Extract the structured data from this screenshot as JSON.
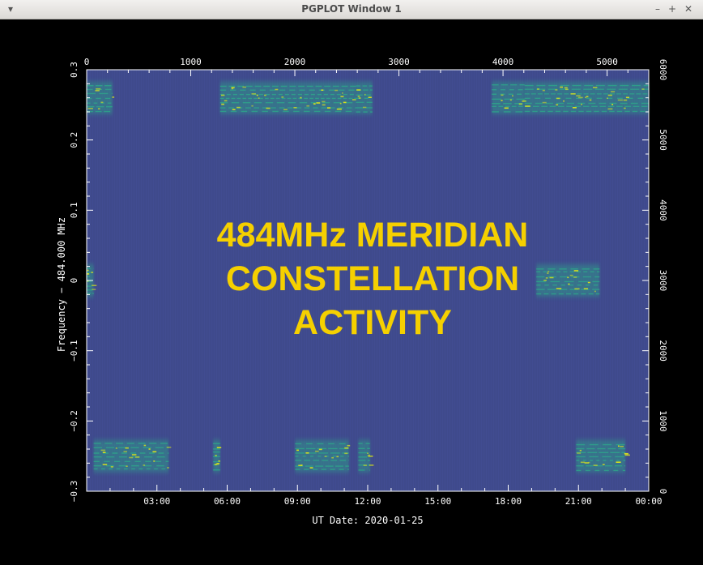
{
  "window": {
    "title": "PGPLOT Window 1",
    "menu_icon": "chevron-down-icon",
    "controls": [
      "minimize-icon",
      "maximize-icon",
      "close-icon"
    ]
  },
  "colors": {
    "background": "#000000",
    "plot_bg": "#3f4a8c",
    "signal_mid": "#2ea48a",
    "signal_high": "#d8e21c",
    "overlay_text": "#f5d000",
    "axes": "#ffffff"
  },
  "chart_data": {
    "type": "heatmap",
    "title": "",
    "overlay_text": [
      "484MHz MERIDIAN",
      "CONSTELLATION",
      "ACTIVITY"
    ],
    "xlabel": "UT Date: 2020-01-25",
    "ylabel": "Frequency − 484.000 MHz",
    "x_ticks": [
      "03:00",
      "06:00",
      "09:00",
      "12:00",
      "15:00",
      "18:00",
      "21:00",
      "00:00"
    ],
    "x_tick_hours": [
      3,
      6,
      9,
      12,
      15,
      18,
      21,
      24
    ],
    "xlim_hours": [
      0,
      24
    ],
    "y_ticks": [
      "0.3",
      "0.2",
      "0.1",
      "0",
      "−0.1",
      "−0.2",
      "−0.3"
    ],
    "y_tick_values": [
      0.3,
      0.2,
      0.1,
      0,
      -0.1,
      -0.2,
      -0.3
    ],
    "ylim": [
      -0.3,
      0.3
    ],
    "top_ticks": [
      "0",
      "1000",
      "2000",
      "3000",
      "4000",
      "5000"
    ],
    "top_tick_values": [
      0,
      1000,
      2000,
      3000,
      4000,
      5000
    ],
    "top_lim": [
      0,
      5400
    ],
    "right_ticks": [
      "6000",
      "5000",
      "4000",
      "3000",
      "2000",
      "1000",
      "0"
    ],
    "right_tick_values": [
      6000,
      5000,
      4000,
      3000,
      2000,
      1000,
      0
    ],
    "right_lim": [
      0,
      6000
    ],
    "activity_bands": [
      {
        "t0": 0.0,
        "t1": 1.1,
        "f": 0.26
      },
      {
        "t0": 5.7,
        "t1": 11.5,
        "f": 0.26
      },
      {
        "t0": 11.5,
        "t1": 12.2,
        "f": 0.26
      },
      {
        "t0": 17.3,
        "t1": 18.7,
        "f": 0.26
      },
      {
        "t0": 18.7,
        "t1": 24.0,
        "f": 0.26
      },
      {
        "t0": 0.0,
        "t1": 0.3,
        "f": 0.0
      },
      {
        "t0": 19.2,
        "t1": 21.9,
        "f": 0.0
      },
      {
        "t0": 0.3,
        "t1": 3.5,
        "f": -0.25
      },
      {
        "t0": 5.4,
        "t1": 5.7,
        "f": -0.25
      },
      {
        "t0": 8.9,
        "t1": 11.2,
        "f": -0.25
      },
      {
        "t0": 11.6,
        "t1": 12.1,
        "f": -0.25
      },
      {
        "t0": 20.9,
        "t1": 23.0,
        "f": -0.25
      }
    ]
  }
}
